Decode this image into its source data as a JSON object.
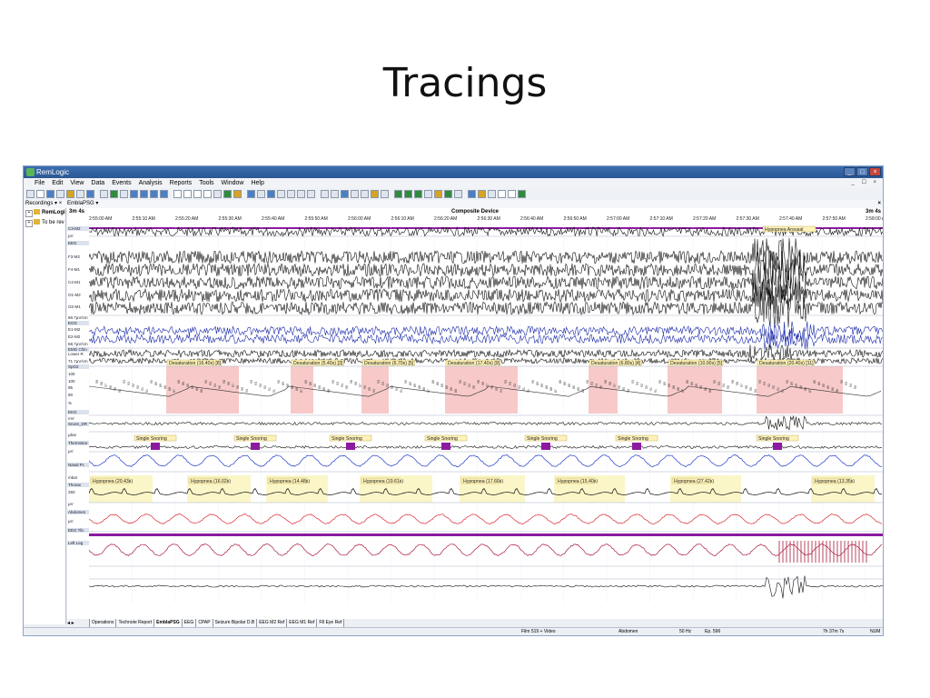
{
  "slide_title": "Tracings",
  "app": {
    "title": "RemLogic"
  },
  "menu": [
    "File",
    "Edit",
    "View",
    "Data",
    "Events",
    "Analysis",
    "Reports",
    "Tools",
    "Window",
    "Help"
  ],
  "window_controls": {
    "minimize": "_",
    "maximize": "□",
    "close": "×"
  },
  "mdi_controls": "_ ☐ ×",
  "panes": {
    "left_header": "Recordings ▾ ×",
    "right_header": "EmblaPSG ▾",
    "close": "×"
  },
  "tree": [
    {
      "label": "RemLogi",
      "bold": true
    },
    {
      "label": "To be rev",
      "bold": false
    }
  ],
  "timebar": {
    "duration_left": "3m 4s",
    "duration_right": "3m 4s",
    "device": "Composite Device",
    "ticks": [
      "2:55:00 AM",
      "2:55:10 AM",
      "2:55:20 AM",
      "2:55:30 AM",
      "2:55:40 AM",
      "2:55:50 AM",
      "2:56:00 AM",
      "2:56:10 AM",
      "2:56:20 AM",
      "2:56:30 AM",
      "2:56:40 AM",
      "2:56:50 AM",
      "2:57:00 AM",
      "2:57:10 AM",
      "2:57:20 AM",
      "2:57:30 AM",
      "2:57:40 AM",
      "2:57:50 AM",
      "2:58:00 A"
    ]
  },
  "channel_labels": [
    "C3-M2",
    "µV",
    "EEG",
    "F3-M2",
    "F4-M1",
    "C4-M1",
    "O1-M2",
    "O2-M1",
    "68.7µV/cm",
    "EOG",
    "E1-M2",
    "E2-M2",
    "68.7µV/cm",
    "EMG Chin",
    "Lower R",
    "71.7µV/cm",
    "SpO2",
    "105",
    "100",
    "95",
    "90",
    "%",
    "EKG",
    "mV",
    "Snore_DR",
    "µbar",
    "Thermistor",
    "µV",
    "Nasal Pr.",
    "mbar",
    "Thorax",
    "250",
    "µV",
    "Abdomen",
    "µV",
    "EEG Tib.",
    "Left Leg"
  ],
  "events": {
    "arousal": "Hypopnea Arousal",
    "desaturations": [
      "Desaturation (16.40s) [8]",
      "Desaturation (5.40s) [3]",
      "Desaturation (6.70s) [5]",
      "Desaturation (17.40s) [9]",
      "Desaturation (6.80s) [4]",
      "Desaturation (10.00s) [5]",
      "Desaturation (20.40s) [11]"
    ],
    "snoring_label": "Single Snoring",
    "hypopneas": [
      "Hypopnea (20.43s)",
      "Hypopnea (16.02s)",
      "Hypopnea (14.48s)",
      "Hypopnea (19.61s)",
      "Hypopnea (17.66s)",
      "Hypopnea (15.40s)",
      "Hypopnea (27.42s)",
      "Hypopnea (13.35s)"
    ]
  },
  "spo2_values": [
    "98",
    "98",
    "97",
    "96",
    "95",
    "94",
    "93",
    "93",
    "92",
    "92",
    "91",
    "91",
    "90",
    "89",
    "89",
    "88",
    "88",
    "87",
    "86",
    "86",
    "85",
    "85",
    "86",
    "88",
    "90",
    "93",
    "94",
    "95"
  ],
  "sheet_tabs": [
    "Operations",
    "Technote Report",
    "EmblaPSG",
    "EEG",
    "CPAP",
    "Seizure Bipolar D.B",
    "EEG M2 Ref",
    "EEG M1 Ref",
    "F8 Eye Ref"
  ],
  "active_tab": "EmblaPSG",
  "status": {
    "film": "Film 519 + Video",
    "channel": "Abdomen",
    "rate": "50 Hz",
    "epoch": "Ep. 596",
    "elapsed": "7h 37m 7s",
    "num": "NUM"
  },
  "colors": {
    "eeg": "#111111",
    "eog": "#1b2aa8",
    "desat": "#f7c9c9",
    "hypopnea": "#fbf6c8",
    "thermistor": "#2138c8",
    "thorax": "#d8262e",
    "abdomen": "#a8193b",
    "purple": "#8c1aa0"
  }
}
